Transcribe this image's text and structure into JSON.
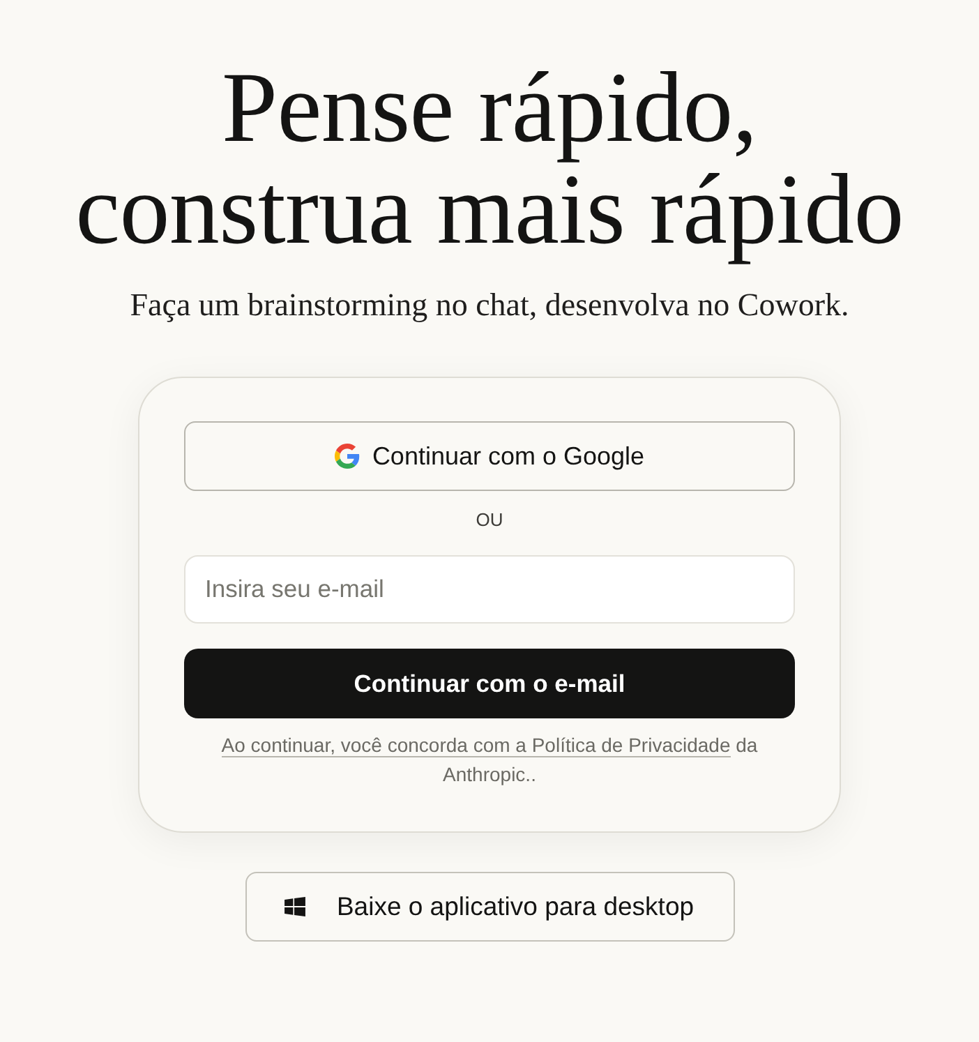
{
  "headline": {
    "lines": [
      "Pense rápido,",
      "construa mais rápido"
    ]
  },
  "subtitle": "Faça um brainstorming no chat, desenvolva no Cowork.",
  "login_card": {
    "google_button": "Continuar com o Google",
    "divider": "OU",
    "email_field": {
      "placeholder": "Insira seu e-mail"
    },
    "email_button": "Continuar com o e-mail",
    "legal": {
      "link": "Ao continuar, você concorda com a Política de Privacidade",
      "text": "da Anthropic.."
    }
  },
  "desktop_button": "Baixe o aplicativo para desktop"
}
